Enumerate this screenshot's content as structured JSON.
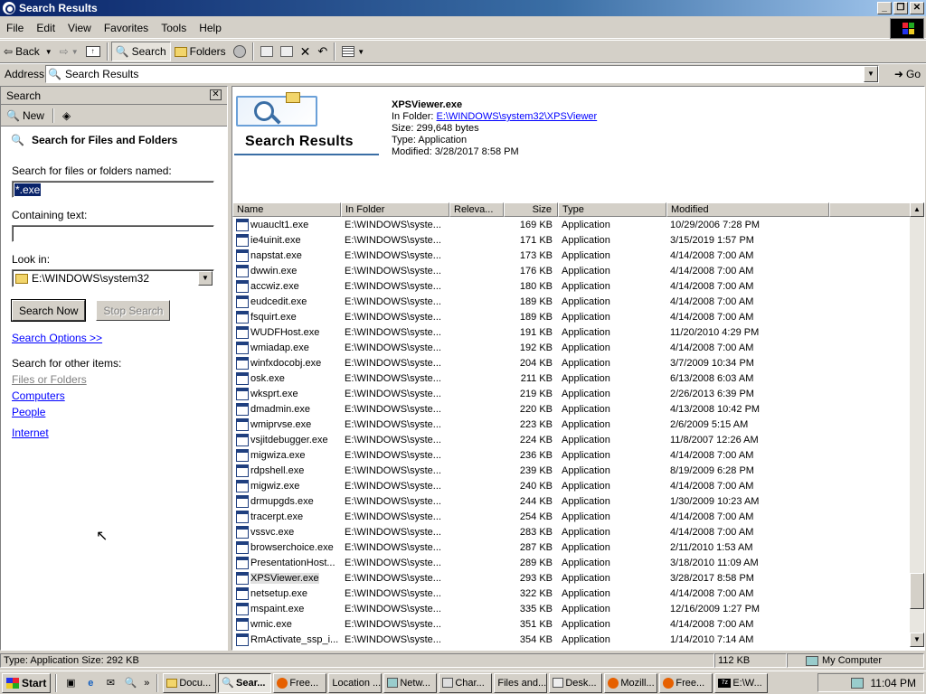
{
  "window": {
    "title": "Search Results"
  },
  "menu": [
    "File",
    "Edit",
    "View",
    "Favorites",
    "Tools",
    "Help"
  ],
  "toolbar": {
    "back": "Back",
    "search": "Search",
    "folders": "Folders"
  },
  "address": {
    "label": "Address",
    "value": "Search Results",
    "go": "Go"
  },
  "search_pane": {
    "header": "Search",
    "new_label": "New",
    "title": "Search for Files and Folders",
    "named_label": "Search for files or folders named:",
    "named_value": "*.exe",
    "containing_label": "Containing text:",
    "containing_value": "",
    "lookin_label": "Look in:",
    "lookin_value": "E:\\WINDOWS\\system32",
    "search_now": "Search Now",
    "stop_search": "Stop Search",
    "options_link": "Search Options >>",
    "other_label": "Search for other items:",
    "other_links": [
      "Files or Folders",
      "Computers",
      "People",
      "Internet"
    ]
  },
  "results_header": {
    "title": "Search Results",
    "file_name": "XPSViewer.exe",
    "folder_label": "In Folder:",
    "folder_link": "E:\\WINDOWS\\system32\\XPSViewer",
    "size": "Size: 299,648 bytes",
    "type": "Type: Application",
    "modified": "Modified: 3/28/2017 8:58 PM"
  },
  "columns": [
    "Name",
    "In Folder",
    "Releva...",
    "Size",
    "Type",
    "Modified"
  ],
  "rows": [
    {
      "name": "wuauclt1.exe",
      "folder": "E:\\WINDOWS\\syste...",
      "size": "169 KB",
      "type": "Application",
      "modified": "10/29/2006 7:28 PM"
    },
    {
      "name": "ie4uinit.exe",
      "folder": "E:\\WINDOWS\\syste...",
      "size": "171 KB",
      "type": "Application",
      "modified": "3/15/2019 1:57 PM"
    },
    {
      "name": "napstat.exe",
      "folder": "E:\\WINDOWS\\syste...",
      "size": "173 KB",
      "type": "Application",
      "modified": "4/14/2008 7:00 AM"
    },
    {
      "name": "dwwin.exe",
      "folder": "E:\\WINDOWS\\syste...",
      "size": "176 KB",
      "type": "Application",
      "modified": "4/14/2008 7:00 AM"
    },
    {
      "name": "accwiz.exe",
      "folder": "E:\\WINDOWS\\syste...",
      "size": "180 KB",
      "type": "Application",
      "modified": "4/14/2008 7:00 AM"
    },
    {
      "name": "eudcedit.exe",
      "folder": "E:\\WINDOWS\\syste...",
      "size": "189 KB",
      "type": "Application",
      "modified": "4/14/2008 7:00 AM"
    },
    {
      "name": "fsquirt.exe",
      "folder": "E:\\WINDOWS\\syste...",
      "size": "189 KB",
      "type": "Application",
      "modified": "4/14/2008 7:00 AM"
    },
    {
      "name": "WUDFHost.exe",
      "folder": "E:\\WINDOWS\\syste...",
      "size": "191 KB",
      "type": "Application",
      "modified": "11/20/2010 4:29 PM"
    },
    {
      "name": "wmiadap.exe",
      "folder": "E:\\WINDOWS\\syste...",
      "size": "192 KB",
      "type": "Application",
      "modified": "4/14/2008 7:00 AM"
    },
    {
      "name": "winfxdocobj.exe",
      "folder": "E:\\WINDOWS\\syste...",
      "size": "204 KB",
      "type": "Application",
      "modified": "3/7/2009 10:34 PM"
    },
    {
      "name": "osk.exe",
      "folder": "E:\\WINDOWS\\syste...",
      "size": "211 KB",
      "type": "Application",
      "modified": "6/13/2008 6:03 AM"
    },
    {
      "name": "wksprt.exe",
      "folder": "E:\\WINDOWS\\syste...",
      "size": "219 KB",
      "type": "Application",
      "modified": "2/26/2013 6:39 PM"
    },
    {
      "name": "dmadmin.exe",
      "folder": "E:\\WINDOWS\\syste...",
      "size": "220 KB",
      "type": "Application",
      "modified": "4/13/2008 10:42 PM"
    },
    {
      "name": "wmiprvse.exe",
      "folder": "E:\\WINDOWS\\syste...",
      "size": "223 KB",
      "type": "Application",
      "modified": "2/6/2009 5:15 AM"
    },
    {
      "name": "vsjitdebugger.exe",
      "folder": "E:\\WINDOWS\\syste...",
      "size": "224 KB",
      "type": "Application",
      "modified": "11/8/2007 12:26 AM"
    },
    {
      "name": "migwiza.exe",
      "folder": "E:\\WINDOWS\\syste...",
      "size": "236 KB",
      "type": "Application",
      "modified": "4/14/2008 7:00 AM"
    },
    {
      "name": "rdpshell.exe",
      "folder": "E:\\WINDOWS\\syste...",
      "size": "239 KB",
      "type": "Application",
      "modified": "8/19/2009 6:28 PM"
    },
    {
      "name": "migwiz.exe",
      "folder": "E:\\WINDOWS\\syste...",
      "size": "240 KB",
      "type": "Application",
      "modified": "4/14/2008 7:00 AM"
    },
    {
      "name": "drmupgds.exe",
      "folder": "E:\\WINDOWS\\syste...",
      "size": "244 KB",
      "type": "Application",
      "modified": "1/30/2009 10:23 AM"
    },
    {
      "name": "tracerpt.exe",
      "folder": "E:\\WINDOWS\\syste...",
      "size": "254 KB",
      "type": "Application",
      "modified": "4/14/2008 7:00 AM"
    },
    {
      "name": "vssvc.exe",
      "folder": "E:\\WINDOWS\\syste...",
      "size": "283 KB",
      "type": "Application",
      "modified": "4/14/2008 7:00 AM"
    },
    {
      "name": "browserchoice.exe",
      "folder": "E:\\WINDOWS\\syste...",
      "size": "287 KB",
      "type": "Application",
      "modified": "2/11/2010 1:53 AM"
    },
    {
      "name": "PresentationHost...",
      "folder": "E:\\WINDOWS\\syste...",
      "size": "289 KB",
      "type": "Application",
      "modified": "3/18/2010 11:09 AM"
    },
    {
      "name": "XPSViewer.exe",
      "folder": "E:\\WINDOWS\\syste...",
      "size": "293 KB",
      "type": "Application",
      "modified": "3/28/2017 8:58 PM"
    },
    {
      "name": "netsetup.exe",
      "folder": "E:\\WINDOWS\\syste...",
      "size": "322 KB",
      "type": "Application",
      "modified": "4/14/2008 7:00 AM"
    },
    {
      "name": "mspaint.exe",
      "folder": "E:\\WINDOWS\\syste...",
      "size": "335 KB",
      "type": "Application",
      "modified": "12/16/2009 1:27 PM"
    },
    {
      "name": "wmic.exe",
      "folder": "E:\\WINDOWS\\syste...",
      "size": "351 KB",
      "type": "Application",
      "modified": "4/14/2008 7:00 AM"
    },
    {
      "name": "RmActivate_ssp_i...",
      "folder": "E:\\WINDOWS\\syste...",
      "size": "354 KB",
      "type": "Application",
      "modified": "1/14/2010 7:14 AM"
    }
  ],
  "status": {
    "left": "Type: Application Size: 292 KB",
    "size": "112 KB",
    "zone": "My Computer"
  },
  "taskbar": {
    "start": "Start",
    "items": [
      "Docu...",
      "Sear...",
      "Free...",
      "Location ...",
      "Netw...",
      "Char...",
      "Files and...",
      "Desk...",
      "Mozill...",
      "Free...",
      "E:\\W..."
    ],
    "clock": "11:04 PM"
  },
  "colors": {
    "title_start": "#0a246a",
    "title_end": "#a6caf0",
    "link": "#0000ff"
  }
}
